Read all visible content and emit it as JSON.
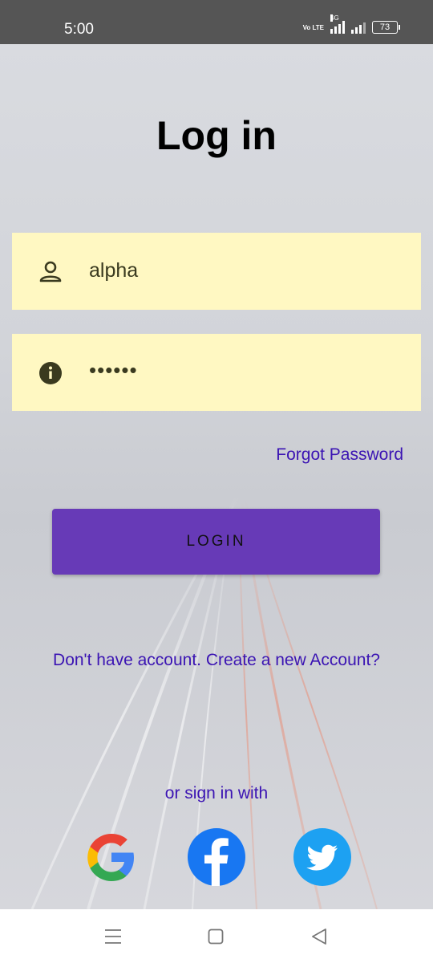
{
  "status_bar": {
    "time": "5:00",
    "network_label": "Vo LTE",
    "network_sub": "LTE",
    "signal_tag": "4G",
    "battery": "73"
  },
  "screen": {
    "title": "Log in",
    "username": {
      "value": "alpha",
      "icon": "person-icon"
    },
    "password": {
      "value": "••••••",
      "icon": "info-icon"
    },
    "forgot_password": "Forgot Password",
    "login_button": "LOGIN",
    "signup_link": "Don't have account. Create a new Account?",
    "or_sign_in": "or sign in with",
    "social": [
      {
        "name": "google",
        "icon": "google-icon"
      },
      {
        "name": "facebook",
        "icon": "facebook-icon"
      },
      {
        "name": "twitter",
        "icon": "twitter-icon"
      }
    ]
  },
  "nav_bar": {
    "icons": [
      "menu-icon",
      "home-icon",
      "back-icon"
    ]
  },
  "colors": {
    "button": "#673ab7",
    "link": "#3b14b3",
    "field_bg": "#fff8c2",
    "status_bar": "#555555"
  }
}
